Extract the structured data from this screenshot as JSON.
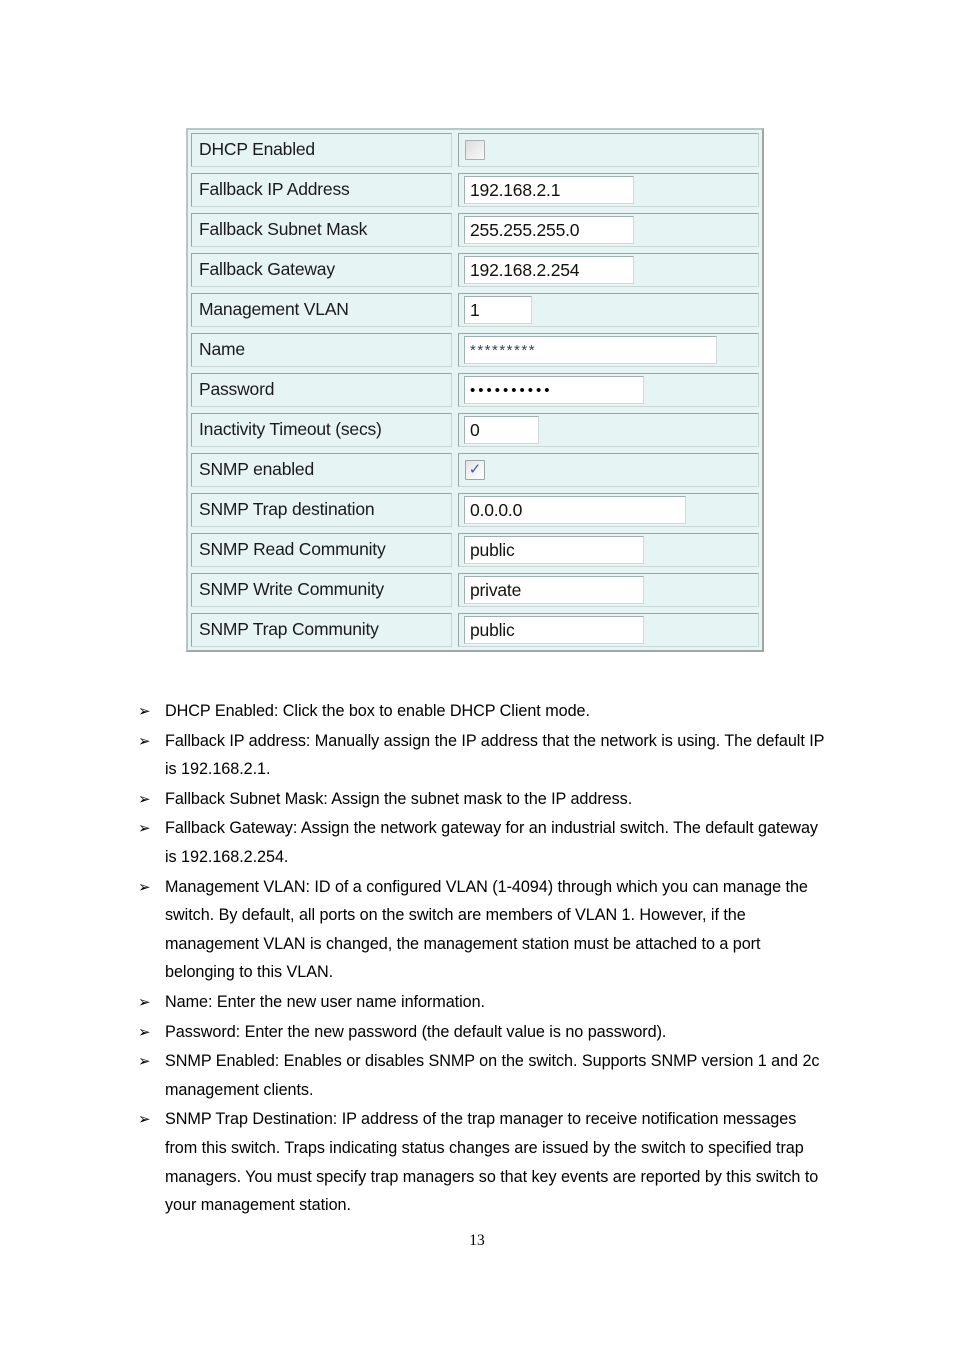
{
  "screenshot": {
    "title": "switch-ip-and-snmp-settings-form",
    "rows": [
      {
        "label": "DHCP Enabled",
        "control": "checkbox",
        "checked": false,
        "value": ""
      },
      {
        "label": "Fallback IP Address",
        "control": "text",
        "value": "192.168.2.1",
        "width": "w-ip"
      },
      {
        "label": "Fallback Subnet Mask",
        "control": "text",
        "value": "255.255.255.0",
        "width": "w-ip"
      },
      {
        "label": "Fallback Gateway",
        "control": "text",
        "value": "192.168.2.254",
        "width": "w-ip"
      },
      {
        "label": "Management VLAN",
        "control": "text",
        "value": "1",
        "width": "w-vlan"
      },
      {
        "label": "Name",
        "control": "stars",
        "value": "*********",
        "width": "w-name"
      },
      {
        "label": "Password",
        "control": "dots",
        "value": "••••••••••",
        "width": "w-pass"
      },
      {
        "label": "Inactivity Timeout (secs)",
        "control": "text",
        "value": "0",
        "width": "w-timeout"
      },
      {
        "label": "SNMP enabled",
        "control": "checkbox",
        "checked": true,
        "value": "✓"
      },
      {
        "label": "SNMP Trap destination",
        "control": "text",
        "value": "0.0.0.0",
        "width": "w-trap"
      },
      {
        "label": "SNMP Read Community",
        "control": "text",
        "value": "public",
        "width": "w-comm"
      },
      {
        "label": "SNMP Write Community",
        "control": "text",
        "value": "private",
        "width": "w-comm"
      },
      {
        "label": "SNMP Trap Community",
        "control": "text",
        "value": "public",
        "width": "w-comm"
      }
    ]
  },
  "notes": {
    "bullet_glyph": "➢",
    "items": [
      "DHCP Enabled: Click the box to enable DHCP Client mode.",
      "Fallback IP address: Manually assign the IP address that the network is using. The default IP is 192.168.2.1.",
      "Fallback Subnet Mask: Assign the subnet mask to the IP address.",
      "Fallback Gateway: Assign the network gateway for an industrial switch. The default gateway is 192.168.2.254.",
      "Management VLAN: ID of a configured VLAN (1-4094) through which you can manage the switch. By default, all ports on the switch are members of VLAN 1. However, if the management VLAN is changed, the management station must be attached to a port belonging to this VLAN.",
      "Name: Enter the new user name information.",
      "Password: Enter the new password (the default value is no password).",
      "SNMP Enabled: Enables or disables SNMP on the switch. Supports SNMP version 1 and 2c management clients.",
      "SNMP Trap Destination: IP address of the trap manager to receive notification messages from this switch. Traps indicating status changes are issued by the switch to specified trap managers. You must specify trap managers so that key events are reported by this switch to your management station."
    ]
  },
  "footer": {
    "page_number": "13"
  },
  "colors": {
    "form_background": "#e6f4f3",
    "form_border": "#9aa8a8",
    "input_background": "#ffffff",
    "checkmark": "#3c5a99",
    "text": "#000000"
  }
}
